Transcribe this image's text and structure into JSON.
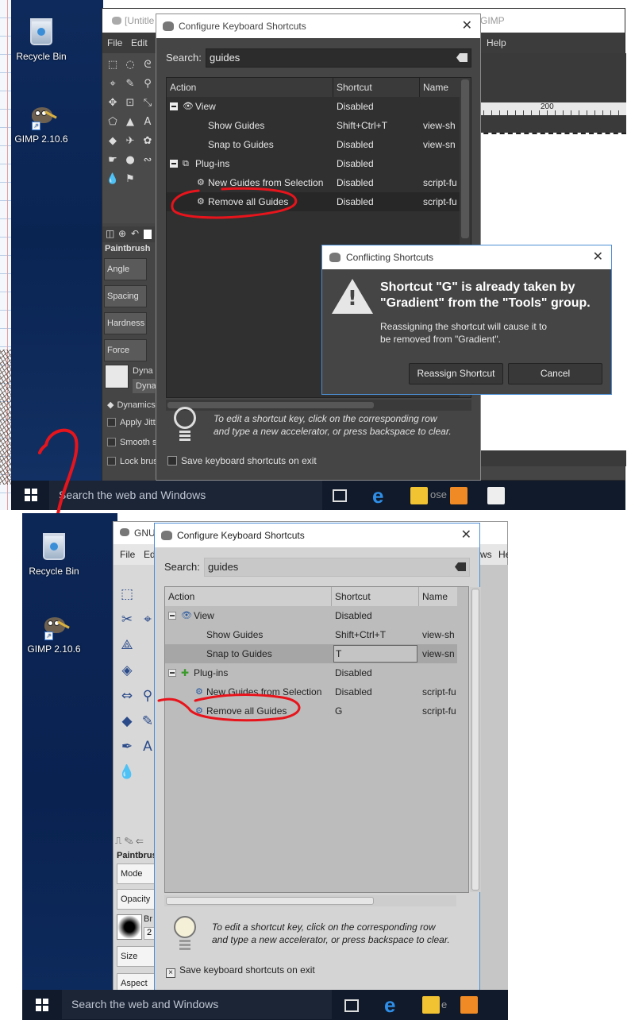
{
  "top": {
    "desktop": {
      "icons": [
        {
          "label": "Recycle Bin",
          "icon": "recycle-bin-icon"
        },
        {
          "label": "GIMP 2.10.6",
          "icon": "gimp-icon"
        }
      ]
    },
    "gimp_window": {
      "title": "[Untitle",
      "title_right": "GIMP",
      "menu": {
        "file": "File",
        "edit": "Edit",
        "help": "Help"
      },
      "ruler_label": "200",
      "brush_panel": {
        "title": "Paintbrush",
        "rows": [
          "Angle",
          "Spacing",
          "Hardness",
          "Force"
        ],
        "dynamics_label": "Dyna",
        "dynamics_field": "Dyna",
        "options": [
          "Dynamics",
          "Apply Jitt",
          "Smooth s",
          "Lock brus"
        ]
      }
    },
    "shortcuts_dialog": {
      "title": "Configure Keyboard Shortcuts",
      "search_label": "Search:",
      "search_value": "guides",
      "columns": [
        "Action",
        "Shortcut",
        "Name"
      ],
      "rows": [
        {
          "level": 0,
          "expander": true,
          "icon": "eye-icon",
          "action": "View",
          "shortcut": "Disabled",
          "name": ""
        },
        {
          "level": 1,
          "expander": false,
          "icon": "",
          "action": "Show Guides",
          "shortcut": "Shift+Ctrl+T",
          "name": "view-sh"
        },
        {
          "level": 1,
          "expander": false,
          "icon": "",
          "action": "Snap to Guides",
          "shortcut": "Disabled",
          "name": "view-sn"
        },
        {
          "level": 0,
          "expander": true,
          "icon": "plugin-icon",
          "action": "Plug-ins",
          "shortcut": "Disabled",
          "name": ""
        },
        {
          "level": 1,
          "expander": false,
          "icon": "script-fu-icon",
          "action": "New Guides from Selection",
          "shortcut": "Disabled",
          "name": "script-fu"
        },
        {
          "level": 1,
          "expander": false,
          "icon": "script-fu-icon",
          "action": "Remove all Guides",
          "shortcut": "Disabled",
          "name": "script-fu",
          "selected": true
        }
      ],
      "hint_line1": "To edit a shortcut key, click on the corresponding row",
      "hint_line2": "and type a new accelerator, or press backspace to clear.",
      "save_label": "Save keyboard shortcuts on exit"
    },
    "conflict_dialog": {
      "title": "Conflicting Shortcuts",
      "headline_line1": "Shortcut \"G\" is already taken by",
      "headline_line2": "\"Gradient\" from the \"Tools\" group.",
      "body_line1": "Reassigning the shortcut will cause it to",
      "body_line2": "be removed from \"Gradient\".",
      "reassign_label": "Reassign Shortcut",
      "cancel_label": "Cancel"
    },
    "taskbar": {
      "search_placeholder": "Search the web and Windows",
      "window_label": "ose"
    }
  },
  "bottom": {
    "desktop": {
      "icons": [
        {
          "label": "Recycle Bin",
          "icon": "recycle-bin-icon"
        },
        {
          "label": "GIMP 2.10.6",
          "icon": "gimp-icon"
        }
      ]
    },
    "gimp_window": {
      "title": "GNU",
      "menu": {
        "file": "File",
        "edit": "Ed",
        "right1": "ws",
        "right2": "He"
      },
      "brush_panel": {
        "title": "Paintbrus",
        "rows": [
          "Mode",
          "Opacity",
          "Size",
          "Aspect Ra"
        ],
        "brush_label": "Br",
        "brush_value": "2"
      }
    },
    "shortcuts_dialog": {
      "title": "Configure Keyboard Shortcuts",
      "search_label": "Search:",
      "search_value": "guides",
      "columns": [
        "Action",
        "Shortcut",
        "Name"
      ],
      "rows": [
        {
          "level": 0,
          "expander": true,
          "icon": "eye-icon",
          "action": "View",
          "shortcut": "Disabled",
          "name": ""
        },
        {
          "level": 1,
          "expander": false,
          "icon": "",
          "action": "Show Guides",
          "shortcut": "Shift+Ctrl+T",
          "name": "view-sh"
        },
        {
          "level": 1,
          "expander": false,
          "icon": "",
          "action": "Snap to Guides",
          "shortcut": "T",
          "name": "view-sn",
          "selected": true
        },
        {
          "level": 0,
          "expander": true,
          "icon": "plugin-icon",
          "action": "Plug-ins",
          "shortcut": "Disabled",
          "name": ""
        },
        {
          "level": 1,
          "expander": false,
          "icon": "script-fu-icon",
          "action": "New Guides from Selection",
          "shortcut": "Disabled",
          "name": "script-fu"
        },
        {
          "level": 1,
          "expander": false,
          "icon": "script-fu-icon",
          "action": "Remove all Guides",
          "shortcut": "G",
          "name": "script-fu"
        }
      ],
      "hint_line1": "To edit a shortcut key, click on the corresponding row",
      "hint_line2": "and type a new accelerator, or press backspace to clear.",
      "save_label": "Save keyboard shortcuts on exit",
      "save_checked_mark": "×"
    },
    "taskbar": {
      "search_placeholder": "Search the web and Windows",
      "window_label": "e"
    }
  },
  "colors": {
    "annotation_red": "#e8141c",
    "dark_theme_bg": "#454545",
    "light_theme_bg": "#d4d4d4",
    "accent_blue": "#4d8fd6"
  }
}
